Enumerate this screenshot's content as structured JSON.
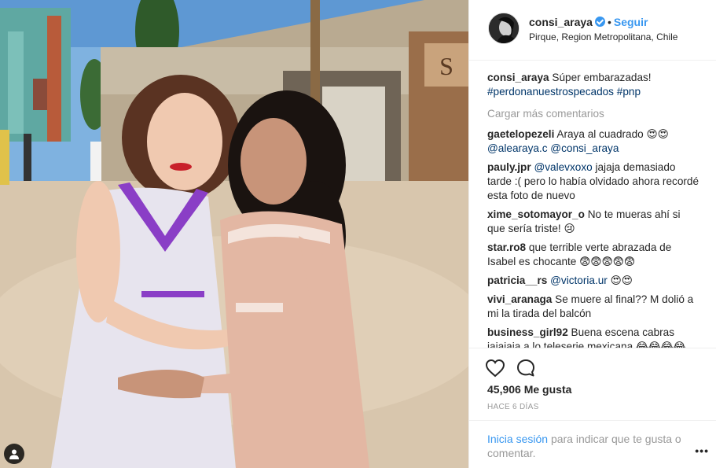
{
  "post": {
    "username": "consi_araya",
    "follow_label": "Seguir",
    "separator": "•",
    "location": "Pirque, Region Metropolitana, Chile",
    "caption_user": "consi_araya",
    "caption_text": "Súper embarazadas!",
    "caption_tags": "#perdonanuestrospecados #pnp",
    "load_more": "Cargar más comentarios",
    "likes": "45,906 Me gusta",
    "time": "HACE 6 DÍAS",
    "login_link": "Inicia sesión",
    "login_text": "para indicar que te gusta o comentar.",
    "more_dots": "•••"
  },
  "comments": [
    {
      "user": "gaetelopezeli",
      "text": "Araya al cuadrado ",
      "emoji": "😍😍",
      "mention": "@alearaya.c @consi_araya",
      "after": ""
    },
    {
      "user": "pauly.jpr",
      "text": "",
      "emoji": "",
      "mention": "@valevxoxo",
      "after": "jajaja demasiado tarde :( pero lo había olvidado ahora recordé esta foto de nuevo"
    },
    {
      "user": "xime_sotomayor_o",
      "text": "No te mueras ahí si que sería triste! ",
      "emoji": "😢",
      "mention": "",
      "after": ""
    },
    {
      "user": "star.ro8",
      "text": "que terrible verte abrazada de Isabel es chocante ",
      "emoji": "😨😨😨😨😨",
      "mention": "",
      "after": ""
    },
    {
      "user": "patricia__rs",
      "text": "",
      "emoji": "",
      "mention": "@victoria.ur",
      "after": "😍😍"
    },
    {
      "user": "vivi_aranaga",
      "text": "Se muere al final?? M dolió a mi la tirada del balcón",
      "emoji": "",
      "mention": "",
      "after": ""
    },
    {
      "user": "business_girl92",
      "text": "Buena escena cabras jajajaja a lo teleserie mexicana ",
      "emoji": "😂😂😂😂",
      "mention": "",
      "after": ""
    }
  ],
  "colors": {
    "link": "#3897f0",
    "hashtag": "#003569",
    "muted": "#999999",
    "border": "#efefef"
  },
  "icons": [
    "verified-badge-icon",
    "heart-icon",
    "comment-bubble-icon",
    "user-tag-icon",
    "more-options-icon"
  ]
}
